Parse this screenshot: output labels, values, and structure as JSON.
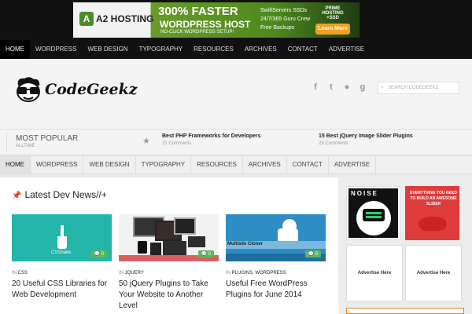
{
  "banner": {
    "brand": "A2 HOSTING",
    "headline": "300% FASTER",
    "subhead": "WORDPRESS HOST",
    "tagline": "NO-CLICK WORDPRESS SETUP!",
    "features": [
      "SwiftServers SSDs",
      "24/7/365 Guru Crew",
      "Free Backups"
    ],
    "offer": "PRIME HOSTING +SSD",
    "cta": "Learn More"
  },
  "main_nav": [
    "HOME",
    "WORDPRESS",
    "WEB DESIGN",
    "TYPOGRAPHY",
    "RESOURCES",
    "ARCHIVES",
    "CONTACT",
    "ADVERTISE"
  ],
  "logo_text": "CodeGeekz",
  "search": {
    "placeholder": "SEARCH CODEGEEKZ"
  },
  "popular": {
    "title": "MOST POPULAR",
    "subtitle": "ALLTIME",
    "items": [
      {
        "title": "Best PHP Frameworks for Developers",
        "comments": "31 Comments"
      },
      {
        "title": "15 Best jQuery Image Slider Plugins",
        "comments": "28 Comments"
      }
    ]
  },
  "sub_nav": [
    "HOME",
    "WORDPRESS",
    "WEB DESIGN",
    "TYPOGRAPHY",
    "RESOURCES",
    "ARCHIVES",
    "CONTACT",
    "ADVERTISE"
  ],
  "section_title": "Latest Dev News//+",
  "posts": [
    {
      "thumb_text": "CSShake",
      "comments": "0",
      "in": "IN",
      "category": "CSS",
      "title": "20 Useful CSS Libraries for Web Development"
    },
    {
      "thumb_text": "",
      "comments": "0",
      "in": "IN",
      "category": "JQUERY",
      "title": "50 jQuery Plugins to Take Your Website to Another Level"
    },
    {
      "thumb_text": "Multisite Cloner",
      "comments": "0",
      "in": "IN",
      "category": "PLUGINS, WORDPRESS",
      "title": "Useful Free WordPress Plugins for June 2014"
    }
  ],
  "sidebar": {
    "noise_text": "NOISE",
    "slider_ad_text": "EVERYTHING YOU NEED TO BUILD AN AWESOME SLIDER",
    "advertise_label": "Advertise Here"
  }
}
